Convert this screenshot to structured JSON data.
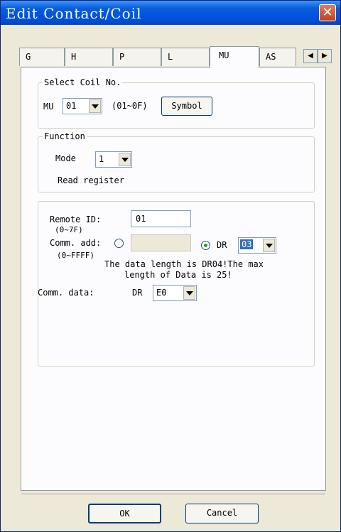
{
  "window": {
    "title": "Edit Contact/Coil",
    "close_glyph": "✕"
  },
  "tabs": [
    {
      "label": "G"
    },
    {
      "label": "H"
    },
    {
      "label": "P"
    },
    {
      "label": "L"
    },
    {
      "label": "MU"
    },
    {
      "label": "AS"
    }
  ],
  "active_tab": "MU",
  "tab_scroll": {
    "left_glyph": "◀",
    "right_glyph": "▶"
  },
  "select_coil": {
    "legend": "Select Coil No.",
    "prefix": "MU",
    "value": "01",
    "range": "(01~0F)",
    "symbol_label": "Symbol"
  },
  "function": {
    "legend": "Function",
    "mode_label": "Mode",
    "mode_value": "1",
    "description": "Read register"
  },
  "remote": {
    "remote_id_label": "Remote ID:",
    "remote_id_range": "(0~7F)",
    "remote_id_value": "01",
    "comm_add_label": "Comm. add:",
    "comm_add_range": "(0~FFFF)",
    "comm_add_value": "",
    "dr_label": "DR",
    "dr_value": "03",
    "info_line1": "The data length is DR04!The max",
    "info_line2": "length of Data is 25!",
    "comm_data_label": "Comm. data:",
    "comm_data_dr_label": "DR",
    "comm_data_value": "E0"
  },
  "buttons": {
    "ok": "OK",
    "cancel": "Cancel"
  },
  "colors": {
    "title_bar": "#0054e3",
    "selection": "#316ac5",
    "radio_dot": "#21a121",
    "close": "#c2401d"
  }
}
